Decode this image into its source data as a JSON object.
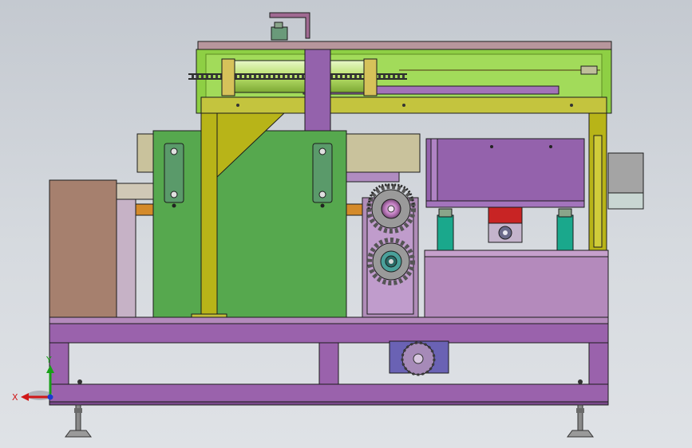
{
  "view": {
    "background_top": "#c4c9d0",
    "background_bottom": "#dfe2e6"
  },
  "triad": {
    "x_label": "X",
    "y_label": "Y",
    "x_color": "#d01818",
    "y_color": "#18a018",
    "z_color": "#1a3ad0"
  },
  "colors": {
    "frame": "#9a62ac",
    "frame_dark": "#7a4a8c",
    "upright": "#b8b418",
    "upright_edge": "#5a5a10",
    "green_housing": "#56a84e",
    "top_enclosure": "#8ecf44",
    "cabinet": "#a6806e",
    "beige_block": "#c9c29c",
    "purple_motor": "#9462ac",
    "pink_base": "#b48abc",
    "teal": "#1aa88c",
    "red_block": "#c82424",
    "orange_rail": "#d48a2a",
    "sprocket": "#9a9a9a",
    "gray_box": "#a4a4a4",
    "slate_blue": "#6a62b4"
  }
}
